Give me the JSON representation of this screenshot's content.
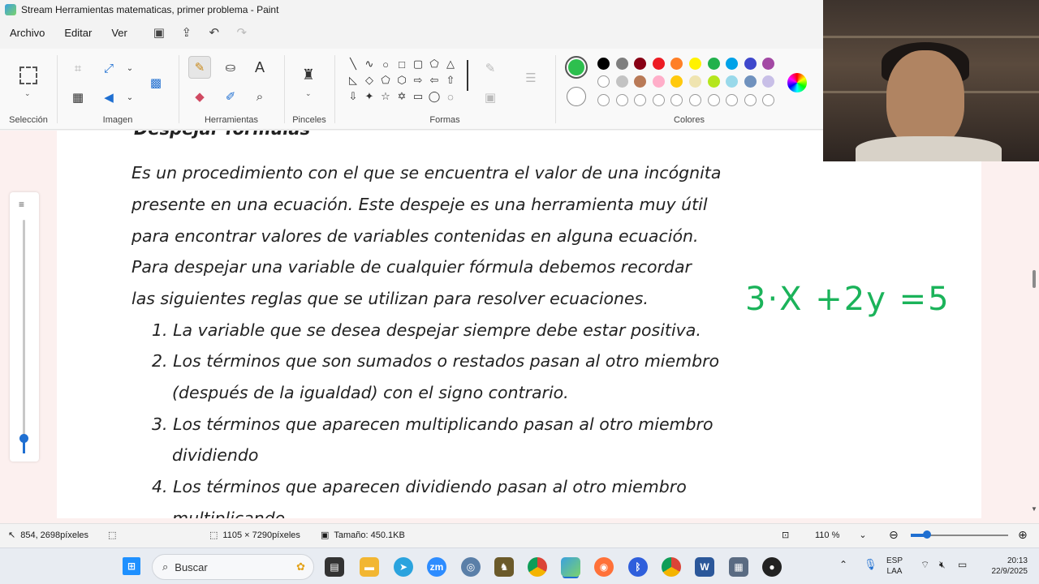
{
  "window": {
    "title": "Stream Herramientas matematicas, primer problema - Paint"
  },
  "menu": {
    "items": [
      "Archivo",
      "Editar",
      "Ver"
    ]
  },
  "ribbon": {
    "groups": {
      "seleccion": "Selección",
      "imagen": "Imagen",
      "herramientas": "Herramientas",
      "pinceles": "Pinceles",
      "formas": "Formas",
      "colores": "Colores"
    },
    "text_tool_glyph": "A",
    "active_color": "#2dbf4e",
    "palette": [
      "#000000",
      "#7f7f7f",
      "#880015",
      "#ed1c24",
      "#ff7f27",
      "#fff200",
      "#22b14c",
      "#00a2e8",
      "#3f48cc",
      "#a349a4",
      "#ffffff",
      "#c3c3c3",
      "#b97a57",
      "#ffaec9",
      "#ffc90e",
      "#efe4b0",
      "#b5e61d",
      "#99d9ea",
      "#7092be",
      "#c8bfe7"
    ]
  },
  "document": {
    "heading": "Despejar fórmulas",
    "paragraph": [
      "Es un procedimiento con el que se encuentra el valor de una incógnita",
      "presente en una ecuación. Este despeje es una herramienta muy útil",
      "para encontrar valores de variables contenidas en alguna ecuación.",
      "Para despejar una variable de cualquier fórmula debemos recordar",
      "las siguientes reglas que se utilizan para resolver ecuaciones."
    ],
    "rules": [
      "1. La variable que se desea despejar siempre debe estar positiva.",
      "2. Los términos que son sumados o restados pasan al otro miembro",
      "(después de la igualdad) con el signo contrario.",
      "3. Los términos que aparecen multiplicando pasan al otro miembro",
      "dividiendo",
      "4. Los términos que aparecen dividiendo pasan al otro miembro",
      "multiplicando"
    ],
    "handwritten_equation": "3·X +2y =5",
    "ink_color": "#1bb35a"
  },
  "status": {
    "cursor_pos": "854, 2698píxeles",
    "dimensions": "1105 × 7290píxeles",
    "size": "Tamaño: 450.1KB",
    "zoom": "110 %",
    "zoom_slider_fraction": 0.17
  },
  "taskbar": {
    "search_placeholder": "Buscar",
    "lang_top": "ESP",
    "lang_bottom": "LAA",
    "time": "20:13",
    "date": "22/9/2025"
  }
}
